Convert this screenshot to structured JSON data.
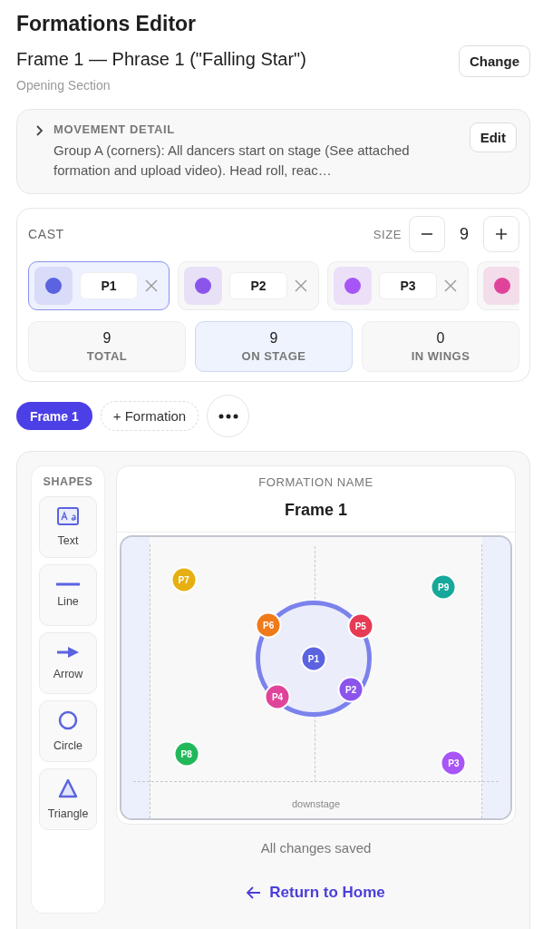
{
  "title": "Formations Editor",
  "frame": {
    "heading": "Frame 1 — Phrase 1 (\"Falling Star\")",
    "subtitle": "Opening Section",
    "change_button": "Change"
  },
  "movement_detail": {
    "label": "MOVEMENT DETAIL",
    "expanded": false,
    "text": "Group A (corners): All dancers start on stage (See attached formation and upload video). Head roll, reac…",
    "edit_button": "Edit"
  },
  "cast": {
    "label": "CAST",
    "size_label": "SIZE",
    "size": "9",
    "members": [
      {
        "name": "P1",
        "color": "#5b63e0",
        "selected": true
      },
      {
        "name": "P2",
        "color": "#8b55ec",
        "selected": false
      },
      {
        "name": "P3",
        "color": "#a855f7",
        "selected": false
      },
      {
        "color": "#e0449a",
        "selected": false
      }
    ],
    "stats": [
      {
        "value": "9",
        "label": "TOTAL",
        "selected": false
      },
      {
        "value": "9",
        "label": "ON STAGE",
        "selected": true
      },
      {
        "value": "0",
        "label": "IN WINGS",
        "selected": false
      }
    ]
  },
  "frames": [
    {
      "label": "Frame 1",
      "selected": true
    }
  ],
  "add_formation_button": "+ Formation",
  "shapes": {
    "label": "SHAPES",
    "items": [
      {
        "kind": "text",
        "label": "Text"
      },
      {
        "kind": "line",
        "label": "Line"
      },
      {
        "kind": "arrow",
        "label": "Arrow"
      },
      {
        "kind": "circle",
        "label": "Circle"
      },
      {
        "kind": "triangle",
        "label": "Triangle"
      }
    ]
  },
  "formation": {
    "name_label": "FORMATION NAME",
    "name": "Frame 1",
    "downstage_label": "downstage",
    "dancers": [
      {
        "label": "P7",
        "color": "#e6b012"
      },
      {
        "label": "P9",
        "color": "#16a89a"
      },
      {
        "label": "P6",
        "color": "#f07a1a"
      },
      {
        "label": "P5",
        "color": "#e63a55"
      },
      {
        "label": "P1",
        "color": "#5b63e0"
      },
      {
        "label": "P2",
        "color": "#8b55ec"
      },
      {
        "label": "P4",
        "color": "#e0449a"
      },
      {
        "label": "P8",
        "color": "#22b85a"
      },
      {
        "label": "P3",
        "color": "#a855f7"
      }
    ]
  },
  "status": "All changes saved",
  "return_link": "Return to Home"
}
